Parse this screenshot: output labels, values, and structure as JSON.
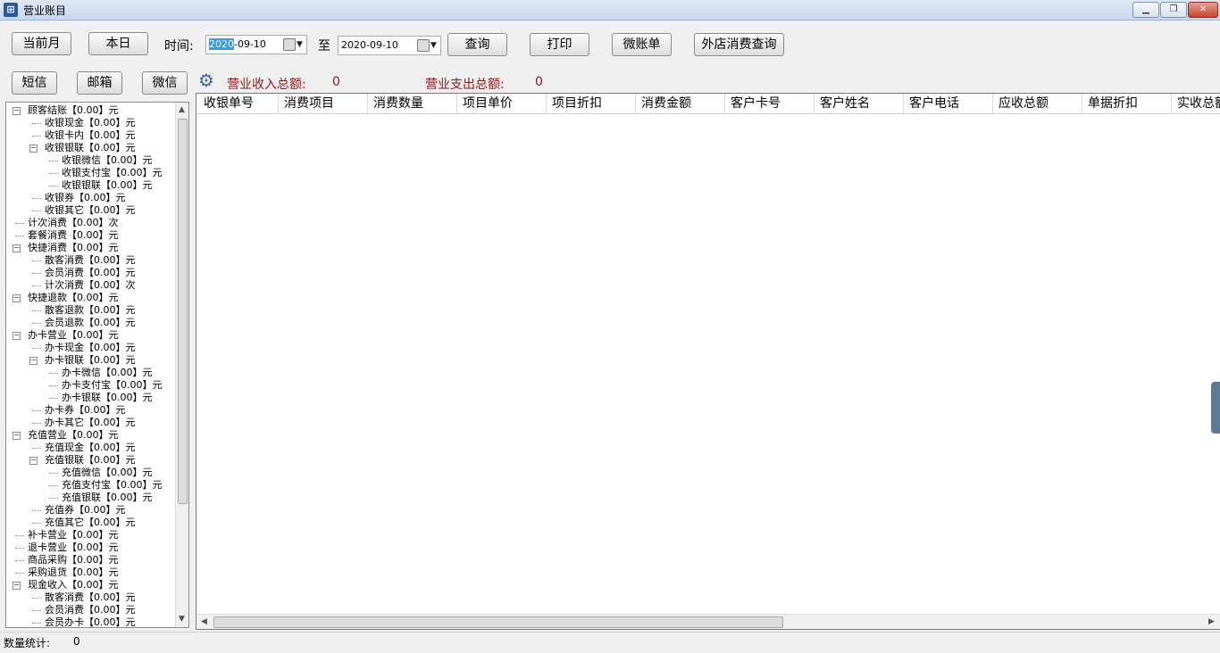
{
  "window": {
    "title": "营业账目",
    "controls": [
      "minimize",
      "restore",
      "close"
    ]
  },
  "toolbar": {
    "current_month": "当前月",
    "today": "本日",
    "time_label": "时间:",
    "date_from_sel": "2020",
    "date_from_rest": "-09-10",
    "to_label": "至",
    "date_to": "2020-09-10",
    "query": "查询",
    "print": "打印",
    "micro_bill": "微账单",
    "external_query": "外店消费查询"
  },
  "send": {
    "sms": "短信",
    "email": "邮箱",
    "wechat": "微信"
  },
  "summary": {
    "income_label": "营业收入总额:",
    "income_value": "0",
    "expense_label": "营业支出总额:",
    "expense_value": "0"
  },
  "tree": [
    {
      "label": "顾客结账【0.00】元",
      "level": 0,
      "expanded": true
    },
    {
      "label": "收银现金【0.00】元",
      "level": 1
    },
    {
      "label": "收银卡内【0.00】元",
      "level": 1
    },
    {
      "label": "收银银联【0.00】元",
      "level": 1,
      "expanded": true
    },
    {
      "label": "收银微信【0.00】元",
      "level": 2
    },
    {
      "label": "收银支付宝【0.00】元",
      "level": 2
    },
    {
      "label": "收银银联【0.00】元",
      "level": 2
    },
    {
      "label": "收银券【0.00】元",
      "level": 1
    },
    {
      "label": "收银其它【0.00】元",
      "level": 1
    },
    {
      "label": "计次消费【0.00】次",
      "level": 0
    },
    {
      "label": "套餐消费【0.00】元",
      "level": 0
    },
    {
      "label": "快捷消费【0.00】元",
      "level": 0,
      "expanded": true
    },
    {
      "label": "散客消费【0.00】元",
      "level": 1
    },
    {
      "label": "会员消费【0.00】元",
      "level": 1
    },
    {
      "label": "计次消费【0.00】次",
      "level": 1
    },
    {
      "label": "快捷退款【0.00】元",
      "level": 0,
      "expanded": true
    },
    {
      "label": "散客退款【0.00】元",
      "level": 1
    },
    {
      "label": "会员退款【0.00】元",
      "level": 1
    },
    {
      "label": "办卡营业【0.00】元",
      "level": 0,
      "expanded": true
    },
    {
      "label": "办卡现金【0.00】元",
      "level": 1
    },
    {
      "label": "办卡银联【0.00】元",
      "level": 1,
      "expanded": true
    },
    {
      "label": "办卡微信【0.00】元",
      "level": 2
    },
    {
      "label": "办卡支付宝【0.00】元",
      "level": 2
    },
    {
      "label": "办卡银联【0.00】元",
      "level": 2
    },
    {
      "label": "办卡券【0.00】元",
      "level": 1
    },
    {
      "label": "办卡其它【0.00】元",
      "level": 1
    },
    {
      "label": "充值营业【0.00】元",
      "level": 0,
      "expanded": true
    },
    {
      "label": "充值现金【0.00】元",
      "level": 1
    },
    {
      "label": "充值银联【0.00】元",
      "level": 1,
      "expanded": true
    },
    {
      "label": "充值微信【0.00】元",
      "level": 2
    },
    {
      "label": "充值支付宝【0.00】元",
      "level": 2
    },
    {
      "label": "充值银联【0.00】元",
      "level": 2
    },
    {
      "label": "充值券【0.00】元",
      "level": 1
    },
    {
      "label": "充值其它【0.00】元",
      "level": 1
    },
    {
      "label": "补卡营业【0.00】元",
      "level": 0
    },
    {
      "label": "退卡营业【0.00】元",
      "level": 0
    },
    {
      "label": "商品采购【0.00】元",
      "level": 0
    },
    {
      "label": "采购退货【0.00】元",
      "level": 0
    },
    {
      "label": "现金收入【0.00】元",
      "level": 0,
      "expanded": true
    },
    {
      "label": "散客消费【0.00】元",
      "level": 1
    },
    {
      "label": "会员消费【0.00】元",
      "level": 1
    },
    {
      "label": "会员办卡【0.00】元",
      "level": 1
    }
  ],
  "grid": {
    "columns": [
      "收银单号",
      "消费项目",
      "消费数量",
      "项目单价",
      "项目折扣",
      "消费金额",
      "客户卡号",
      "客户姓名",
      "客户电话",
      "应收总额",
      "单据折扣",
      "实收总额"
    ],
    "rows": []
  },
  "status": {
    "count_label": "数量统计:",
    "count_value": "0"
  },
  "colors": {
    "summary_text": "#8b1a1a",
    "selection": "#3399ff",
    "gear": "#3a6b9f"
  }
}
